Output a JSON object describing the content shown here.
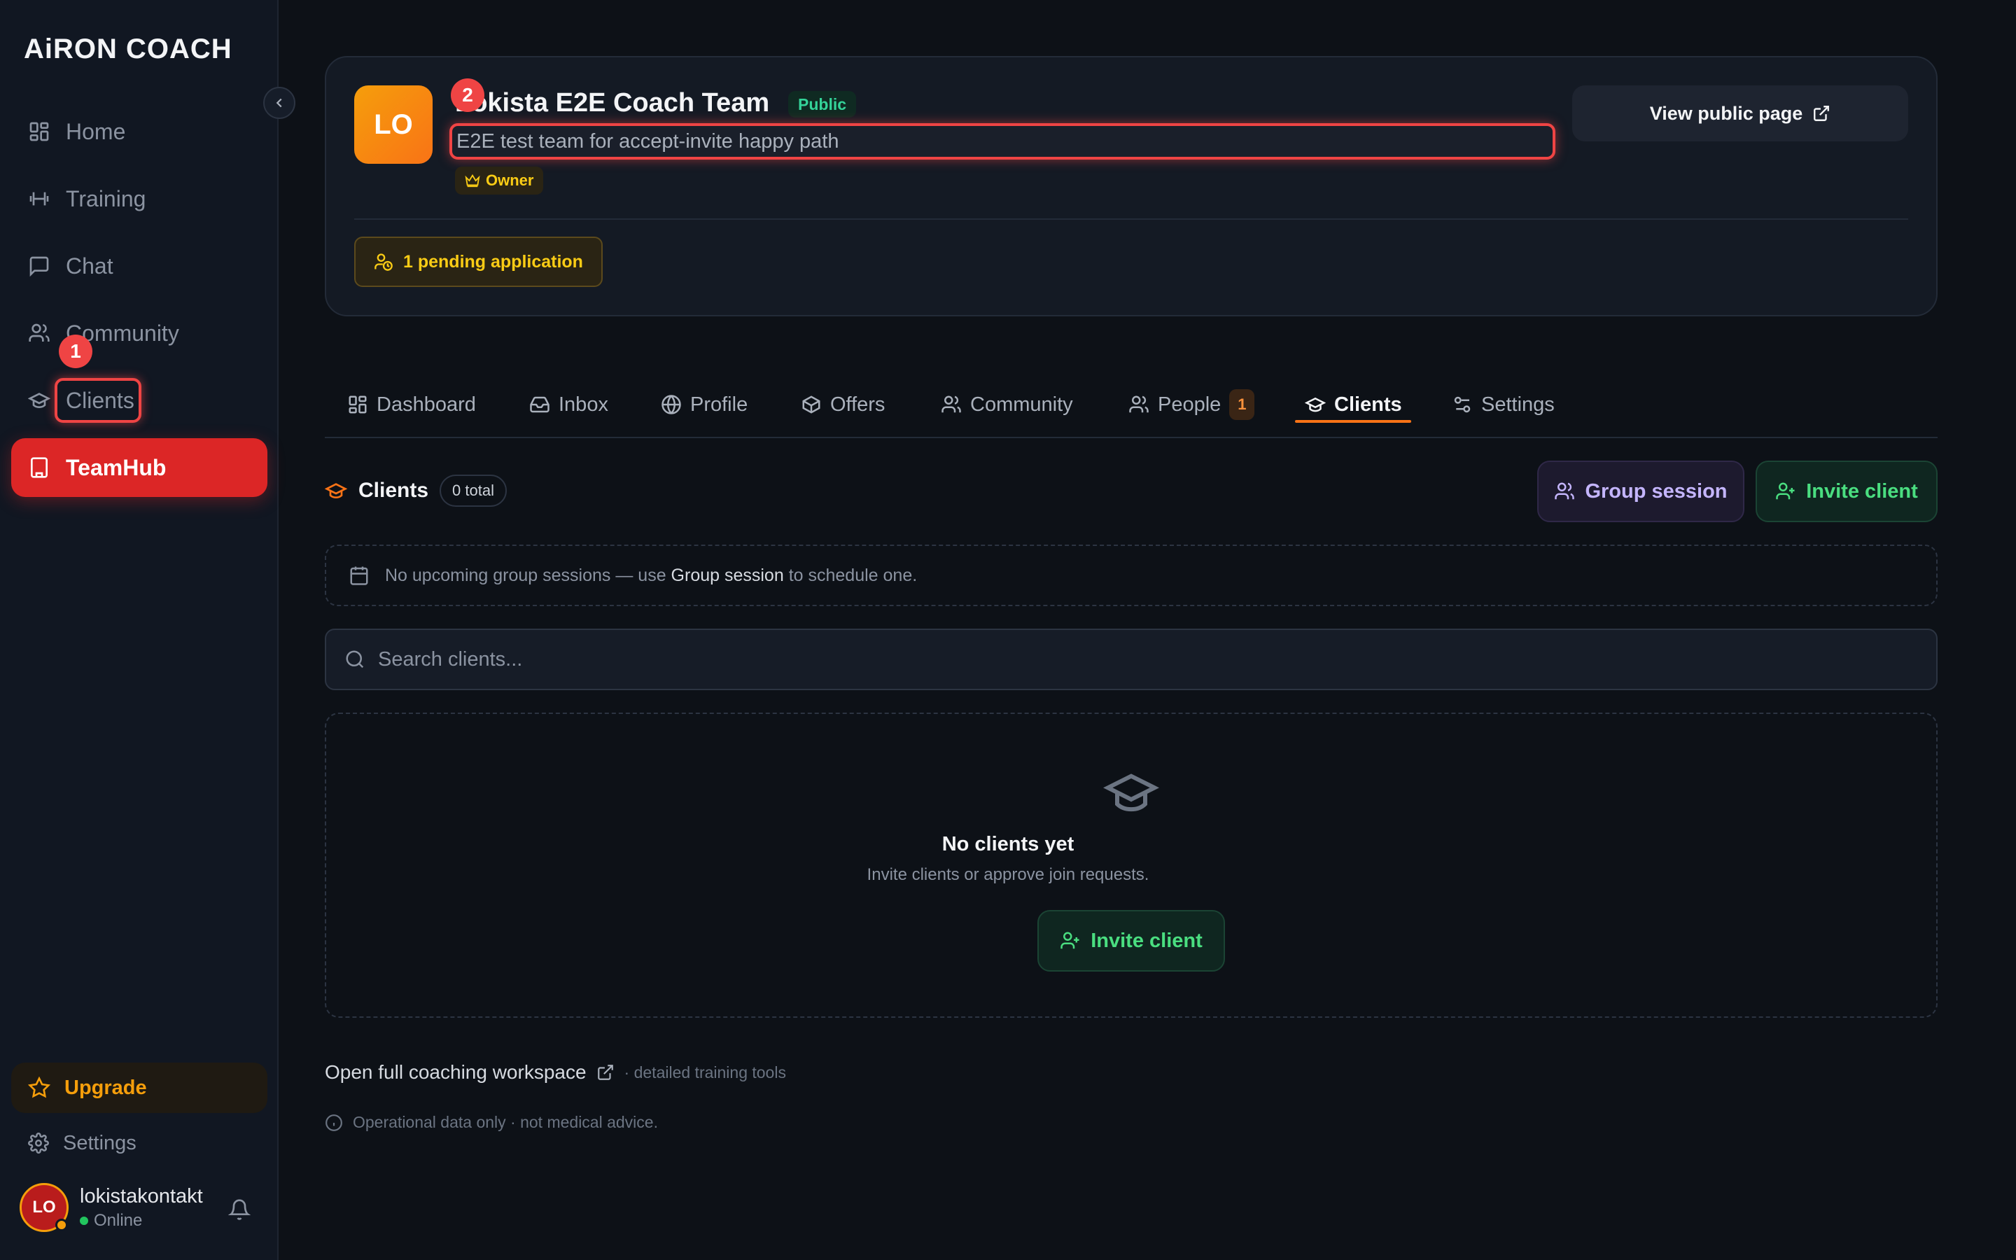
{
  "app": {
    "logo_ai": "AiRON",
    "logo_rest": " COACH"
  },
  "sidebar": {
    "items": [
      {
        "label": "Home",
        "icon": "grid-icon"
      },
      {
        "label": "Training",
        "icon": "dumbbell-icon"
      },
      {
        "label": "Chat",
        "icon": "chat-icon"
      },
      {
        "label": "Community",
        "icon": "users-icon"
      },
      {
        "label": "Clients",
        "icon": "graduation-cap-icon"
      },
      {
        "label": "TeamHub",
        "icon": "building-icon"
      }
    ],
    "upgrade_label": "Upgrade",
    "settings_label": "Settings",
    "user": {
      "initials": "LO",
      "name": "lokistakontakt",
      "status": "Online"
    }
  },
  "markers": {
    "m1": "1",
    "m2": "2"
  },
  "team": {
    "initials": "LO",
    "name": "Lokista E2E Coach Team",
    "visibility": "Public",
    "description": "E2E test team for accept-invite happy path",
    "role": "Owner",
    "view_public_label": "View public page",
    "pending_label": "1 pending application"
  },
  "tabs": [
    {
      "label": "Dashboard"
    },
    {
      "label": "Inbox"
    },
    {
      "label": "Profile"
    },
    {
      "label": "Offers"
    },
    {
      "label": "Community"
    },
    {
      "label": "People",
      "count": "1"
    },
    {
      "label": "Clients"
    },
    {
      "label": "Settings"
    }
  ],
  "clients": {
    "title": "Clients",
    "total": "0 total",
    "group_session_label": "Group session",
    "invite_label": "Invite client",
    "notice_pre": "No upcoming group sessions — use ",
    "notice_strong": "Group session",
    "notice_post": " to schedule one.",
    "search_placeholder": "Search clients...",
    "empty_title": "No clients yet",
    "empty_sub": "Invite clients or approve join requests.",
    "empty_invite_label": "Invite client"
  },
  "footer": {
    "workspace_label": "Open full coaching workspace",
    "workspace_sub": "· detailed training tools",
    "disclaimer": "Operational data only · not medical advice."
  },
  "colors": {
    "accent_red": "#dc2626",
    "accent_orange": "#f97316",
    "green": "#4ade80",
    "purple": "#c4b5fd",
    "amber": "#f59e0b"
  }
}
